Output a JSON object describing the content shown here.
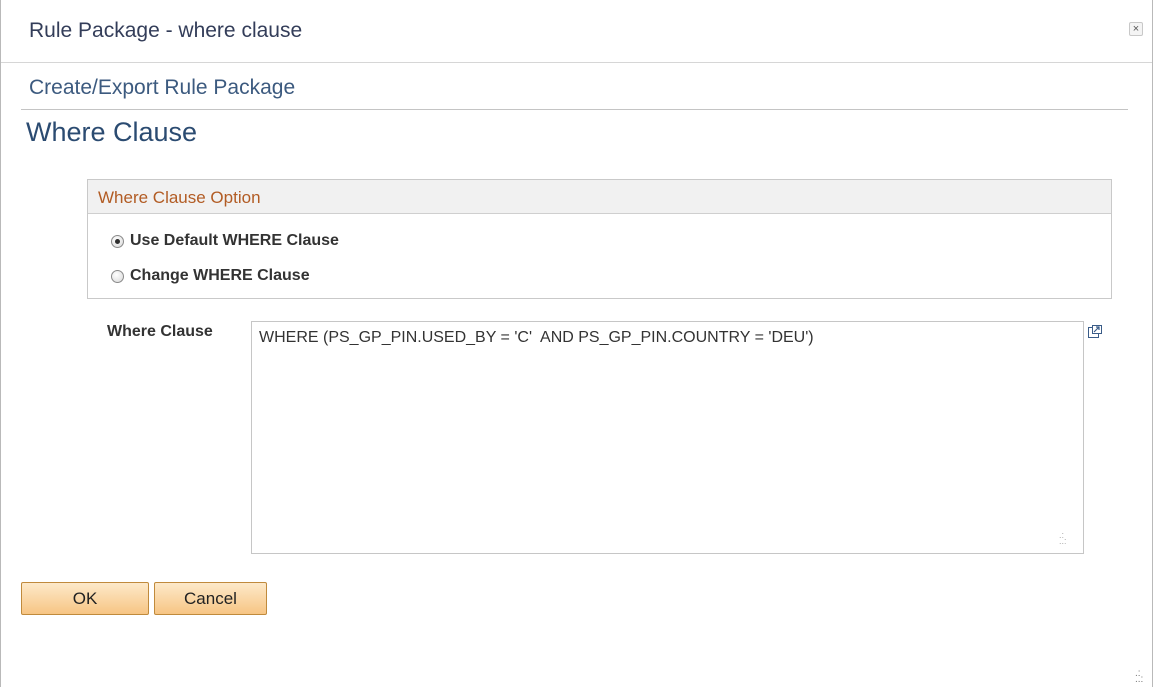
{
  "dialog": {
    "title": "Rule Package - where clause",
    "close_label": "×"
  },
  "page": {
    "header": "Create/Export Rule Package",
    "subtitle": "Where Clause"
  },
  "where_clause_option": {
    "title": "Where Clause Option",
    "options": [
      {
        "label": "Use Default WHERE Clause",
        "checked": true
      },
      {
        "label": "Change WHERE Clause",
        "checked": false
      }
    ]
  },
  "where_clause_field": {
    "label": "Where Clause",
    "value": "WHERE (PS_GP_PIN.USED_BY = 'C'  AND PS_GP_PIN.COUNTRY = 'DEU')"
  },
  "buttons": {
    "ok": "OK",
    "cancel": "Cancel"
  }
}
